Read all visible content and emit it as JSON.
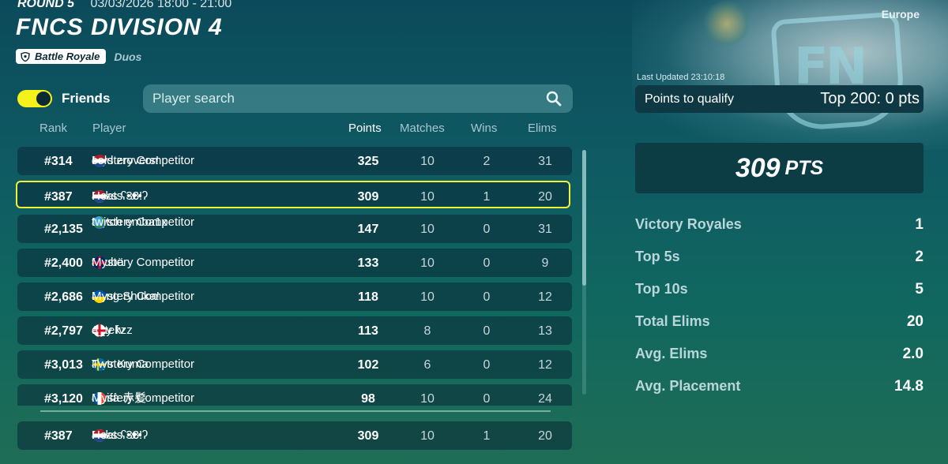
{
  "header": {
    "round": "ROUND 5",
    "dates": "03/03/2026 18:00 - 21:00",
    "title": "FNCS DIVISION 4",
    "mode": "Battle Royale",
    "team_size": "Duos",
    "region": "Europe"
  },
  "controls": {
    "friends_label": "Friends",
    "friends_toggle_on": true,
    "search_placeholder": "Player search"
  },
  "columns": {
    "rank": "Rank",
    "player": "Player",
    "points": "Points",
    "matches": "Matches",
    "wins": "Wins",
    "elims": "Elims"
  },
  "rows": [
    {
      "rank": "#314",
      "p1": "Mystery Competitor",
      "f1": "",
      "sep": " & ",
      "f2": "nl",
      "p2": "cold zrovers!",
      "points": "325",
      "matches": "10",
      "wins": "2",
      "elims": "31"
    },
    {
      "rank": "#387",
      "p1": "Bcks ʕ•ᴥ•ʔ",
      "f1": "ie",
      "sep": " & ",
      "f2": "nl",
      "p2": "Heats 33!",
      "points": "309",
      "matches": "10",
      "wins": "1",
      "elims": "20"
    },
    {
      "rank": "#2,135",
      "p1": "Mystery Competitor",
      "f1": "nl",
      "sep": " & ",
      "f2": "globe",
      "p2": "twitch emba1x",
      "points": "147",
      "matches": "10",
      "wins": "0",
      "elims": "31"
    },
    {
      "rank": "#2,400",
      "p1": "9kubä",
      "f1": "scot",
      "sep": " & ",
      "f2": "gb",
      "p2": "Mystery Competitor",
      "points": "133",
      "matches": "10",
      "wins": "0",
      "elims": "9"
    },
    {
      "rank": "#2,686",
      "p1": "K1ng Shuka!",
      "f1": "gb",
      "sep": " & ",
      "f2": "ua",
      "p2": "Mystery Competitor",
      "points": "118",
      "matches": "10",
      "wins": "0",
      "elims": "12"
    },
    {
      "rank": "#2,797",
      "p1": "cizy fv",
      "f1": "gb",
      "sep": " & ",
      "f2": "eng",
      "p2": "a_tekzz",
      "points": "113",
      "matches": "8",
      "wins": "0",
      "elims": "13"
    },
    {
      "rank": "#3,013",
      "p1": "Mystery Competitor",
      "f1": "",
      "sep": " & ",
      "f2": "se",
      "p2": "Twtr Kuma",
      "points": "102",
      "matches": "6",
      "wins": "0",
      "elims": "12"
    },
    {
      "rank": "#3,120",
      "p1": "Chifà 赤髪",
      "f1": "fr",
      "sep": " & ",
      "f2": "fr",
      "p2": "Mystery Competitor",
      "points": "98",
      "matches": "10",
      "wins": "0",
      "elims": "24"
    }
  ],
  "self_row": {
    "rank": "#387",
    "p1": "Bcks ʕ•ᴥ•ʔ",
    "sep": " & ",
    "p2": "Heats 33!",
    "points": "309",
    "matches": "10",
    "wins": "1",
    "elims": "20"
  },
  "side": {
    "last_updated": "Last Updated 23:10:18",
    "qualify_label": "Points to qualify",
    "qualify_value": "Top 200: 0 pts",
    "points_value": "309",
    "points_unit": "PTS",
    "stats": [
      {
        "label": "Victory Royales",
        "value": "1"
      },
      {
        "label": "Top 5s",
        "value": "2"
      },
      {
        "label": "Top 10s",
        "value": "5"
      },
      {
        "label": "Total Elims",
        "value": "20"
      },
      {
        "label": "Avg. Elims",
        "value": "2.0"
      },
      {
        "label": "Avg. Placement",
        "value": "14.8"
      }
    ]
  },
  "colors": {
    "highlight": "#f2f23a",
    "toggle": "#f4f21a"
  }
}
